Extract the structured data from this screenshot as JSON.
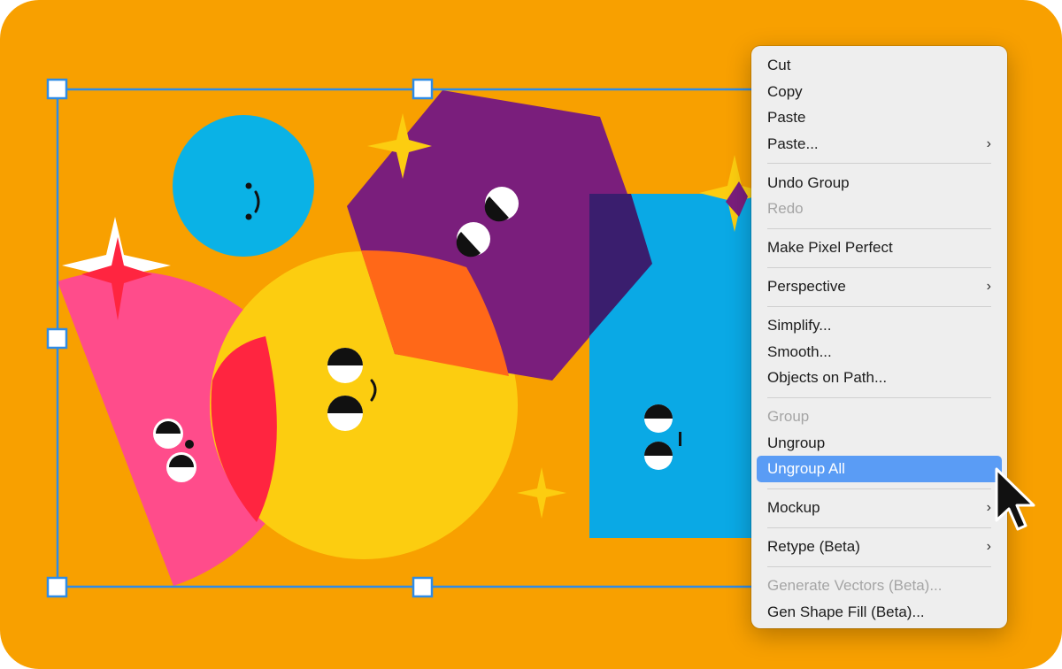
{
  "colors": {
    "background": "#F8A000",
    "circle_blue": "#0AB2E6",
    "hexagon_purple": "#7A1E7C",
    "circle_yellow": "#FCCD10",
    "wedge_pink": "#FF4C8B",
    "rect_blue": "#0AA9E5",
    "selection": "#2E8BE6",
    "menu_bg": "#EEEEEE",
    "menu_highlight": "#5A9CF5"
  },
  "canvas": {
    "shapes": [
      "blue-circle",
      "purple-hexagon",
      "yellow-circle",
      "pink-wedge",
      "blue-rectangle",
      "star-sparkles"
    ],
    "selection_handles": [
      "top-left",
      "top-center",
      "middle-left",
      "bottom-left",
      "bottom-center"
    ]
  },
  "context_menu": {
    "items": [
      {
        "label": "Cut"
      },
      {
        "label": "Copy"
      },
      {
        "label": "Paste"
      },
      {
        "label": "Paste...",
        "chevron": "›"
      },
      {
        "label": "Undo Group"
      },
      {
        "label": "Redo",
        "disabled": true
      },
      {
        "label": "Make Pixel Perfect"
      },
      {
        "label": "Perspective",
        "chevron": "›"
      },
      {
        "label": "Simplify..."
      },
      {
        "label": "Smooth..."
      },
      {
        "label": "Objects on Path..."
      },
      {
        "label": "Group",
        "disabled": true
      },
      {
        "label": "Ungroup"
      },
      {
        "label": "Ungroup All",
        "selected": true
      },
      {
        "label": "Mockup",
        "chevron": "›"
      },
      {
        "label": "Retype (Beta)",
        "chevron": "›"
      },
      {
        "label": "Generate Vectors (Beta)...",
        "disabled": true
      },
      {
        "label": "Gen Shape Fill (Beta)..."
      }
    ]
  },
  "cursor": {
    "icon": "arrow-pointer-icon"
  }
}
